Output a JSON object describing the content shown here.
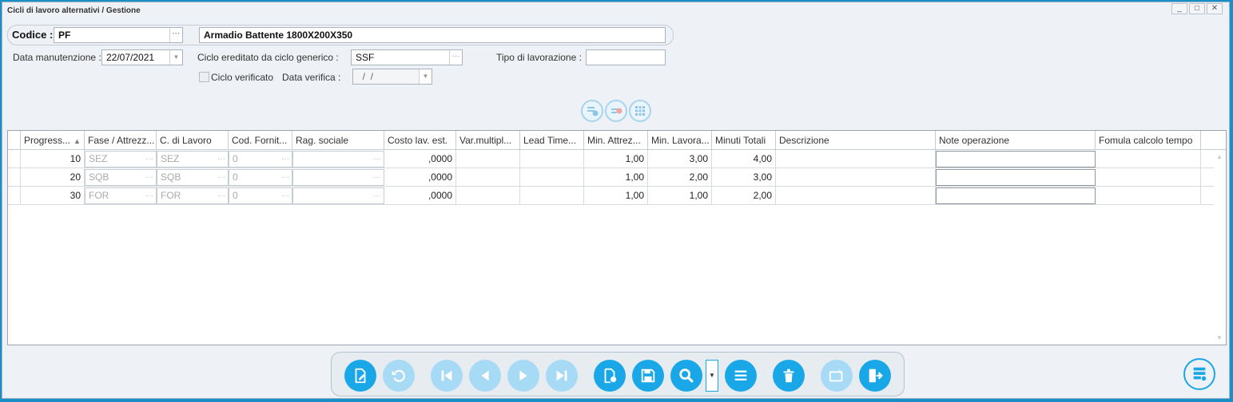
{
  "window": {
    "title": "Cicli di lavoro alternativi / Gestione",
    "controls": [
      "_",
      "□",
      "✕"
    ]
  },
  "form": {
    "codice_label": "Codice :",
    "codice_value": "PF",
    "descrizione_value": "Armadio Battente 1800X200X350",
    "data_manutenzione_label": "Data manutenzione :",
    "data_manutenzione_value": "22/07/2021",
    "ciclo_ereditato_label": "Ciclo ereditato da ciclo generico :",
    "ciclo_ereditato_value": "SSF",
    "tipo_lavorazione_label": "Tipo di lavorazione :",
    "tipo_lavorazione_value": "",
    "ciclo_verificato_label": "Ciclo verificato",
    "ciclo_verificato_checked": false,
    "data_verifica_label": "Data verifica :",
    "data_verifica_value": "  /  /"
  },
  "grid": {
    "columns": [
      "Progress...",
      "Fase / Attrezz...",
      "C. di Lavoro",
      "Cod. Fornit...",
      "Rag. sociale",
      "Costo lav. est.",
      "Var.multipl...",
      "Lead Time...",
      "Min. Attrez...",
      "Min. Lavora...",
      "Minuti Totali",
      "Descrizione",
      "Note operazione",
      "Fomula calcolo tempo"
    ],
    "sorted_column": "Progress...",
    "rows": [
      {
        "prog": "10",
        "fase": "SEZ",
        "cdl": "SEZ",
        "forn": "0",
        "rag": "",
        "costo": ",0000",
        "var": "",
        "lead": "",
        "attrez": "1,00",
        "lavora": "3,00",
        "totali": "4,00",
        "descr": "",
        "note": "",
        "formula": ""
      },
      {
        "prog": "20",
        "fase": "SQB",
        "cdl": "SQB",
        "forn": "0",
        "rag": "",
        "costo": ",0000",
        "var": "",
        "lead": "",
        "attrez": "1,00",
        "lavora": "2,00",
        "totali": "3,00",
        "descr": "",
        "note": "",
        "formula": ""
      },
      {
        "prog": "30",
        "fase": "FOR",
        "cdl": "FOR",
        "forn": "0",
        "rag": "",
        "costo": ",0000",
        "var": "",
        "lead": "",
        "attrez": "1,00",
        "lavora": "1,00",
        "totali": "2,00",
        "descr": "",
        "note": "",
        "formula": ""
      }
    ]
  },
  "toolbar": {
    "buttons": [
      "edit-document",
      "undo",
      "first-record",
      "previous-record",
      "next-record",
      "last-record",
      "new-document",
      "save",
      "search",
      "list",
      "delete",
      "card-edit",
      "exit"
    ],
    "disabled": [
      "undo",
      "first-record",
      "previous-record",
      "next-record",
      "last-record",
      "card-edit"
    ]
  },
  "colors": {
    "accent": "#1aa7e8",
    "accent_disabled": "#a7daf5",
    "frame": "#1a8fc6"
  }
}
